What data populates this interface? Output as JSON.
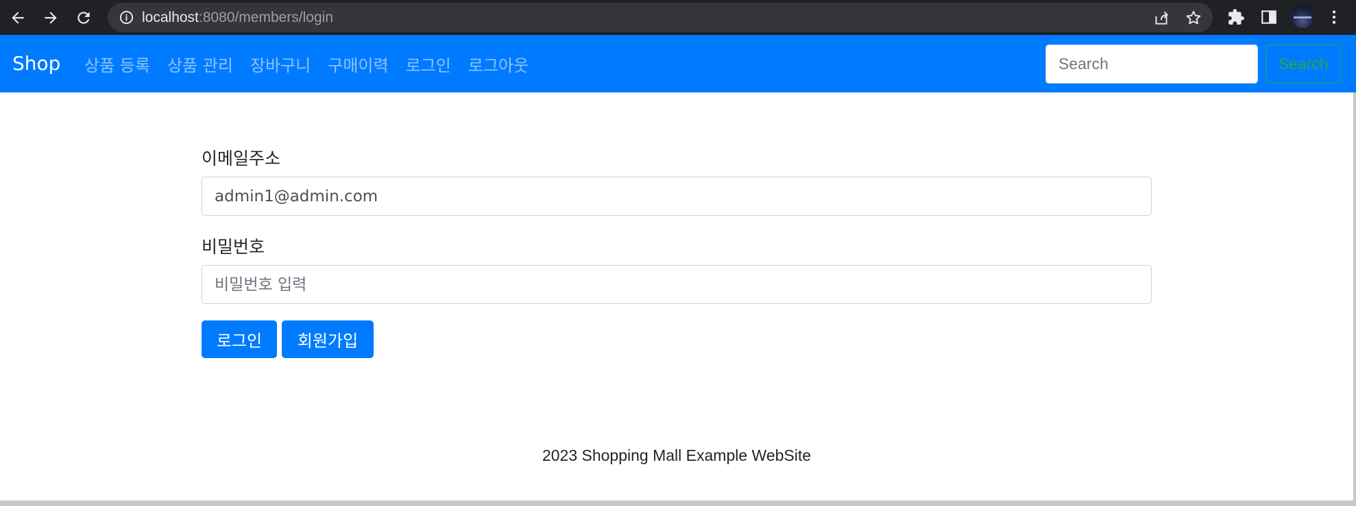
{
  "browser": {
    "url_host": "localhost",
    "url_path": ":8080/members/login",
    "icons": {
      "back": "arrow-left-icon",
      "forward": "arrow-right-icon",
      "reload": "reload-icon",
      "info": "info-icon",
      "share": "share-icon",
      "bookmark": "star-icon",
      "extensions": "puzzle-icon",
      "side_panel": "side-panel-icon",
      "menu": "kebab-menu-icon"
    }
  },
  "navbar": {
    "brand": "Shop",
    "links": [
      "상품 등록",
      "상품 관리",
      "장바구니",
      "구매이력",
      "로그인",
      "로그아웃"
    ],
    "search_placeholder": "Search",
    "search_button": "Search",
    "colors": {
      "background": "#007bff",
      "search_button": "#28a745"
    }
  },
  "login_form": {
    "email_label": "이메일주소",
    "email_value": "admin1@admin.com",
    "password_label": "비밀번호",
    "password_placeholder": "비밀번호 입력",
    "login_button": "로그인",
    "signup_button": "회원가입"
  },
  "footer": {
    "text": "2023 Shopping Mall Example WebSite"
  }
}
